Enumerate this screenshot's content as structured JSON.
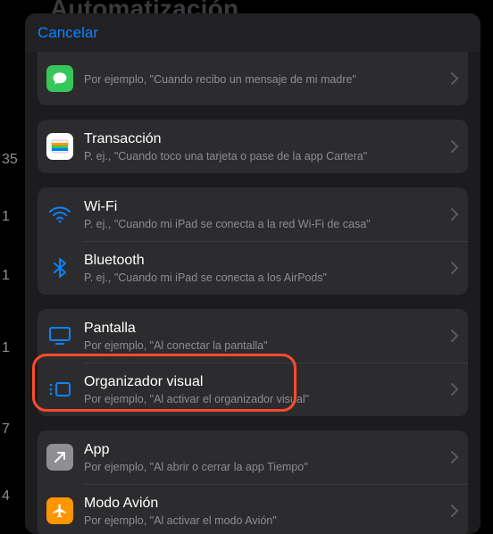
{
  "background": {
    "title": "Automatización",
    "side_numbers": [
      "35",
      "1",
      "1",
      "1",
      "7",
      "4"
    ]
  },
  "nav": {
    "cancel": "Cancelar"
  },
  "rows": {
    "message": {
      "title": "",
      "sub": "Por ejemplo, \"Cuando recibo un mensaje de mi madre\""
    },
    "transaction": {
      "title": "Transacción",
      "sub": "P. ej., \"Cuando toco una tarjeta o pase de la app Cartera\""
    },
    "wifi": {
      "title": "Wi-Fi",
      "sub": "P. ej., \"Cuando mi iPad se conecta a la red Wi-Fi de casa\""
    },
    "bluetooth": {
      "title": "Bluetooth",
      "sub": "P. ej., \"Cuando mi iPad se conecta a los AirPods\""
    },
    "display": {
      "title": "Pantalla",
      "sub": "Por ejemplo, \"Al conectar la pantalla\""
    },
    "stage": {
      "title": "Organizador visual",
      "sub": "Por ejemplo, \"Al activar el organizador visual\""
    },
    "app": {
      "title": "App",
      "sub": "Por ejemplo, \"Al abrir o cerrar la app Tiempo\""
    },
    "airplane": {
      "title": "Modo Avión",
      "sub": "Por ejemplo, \"Al activar el modo Avión\""
    }
  }
}
